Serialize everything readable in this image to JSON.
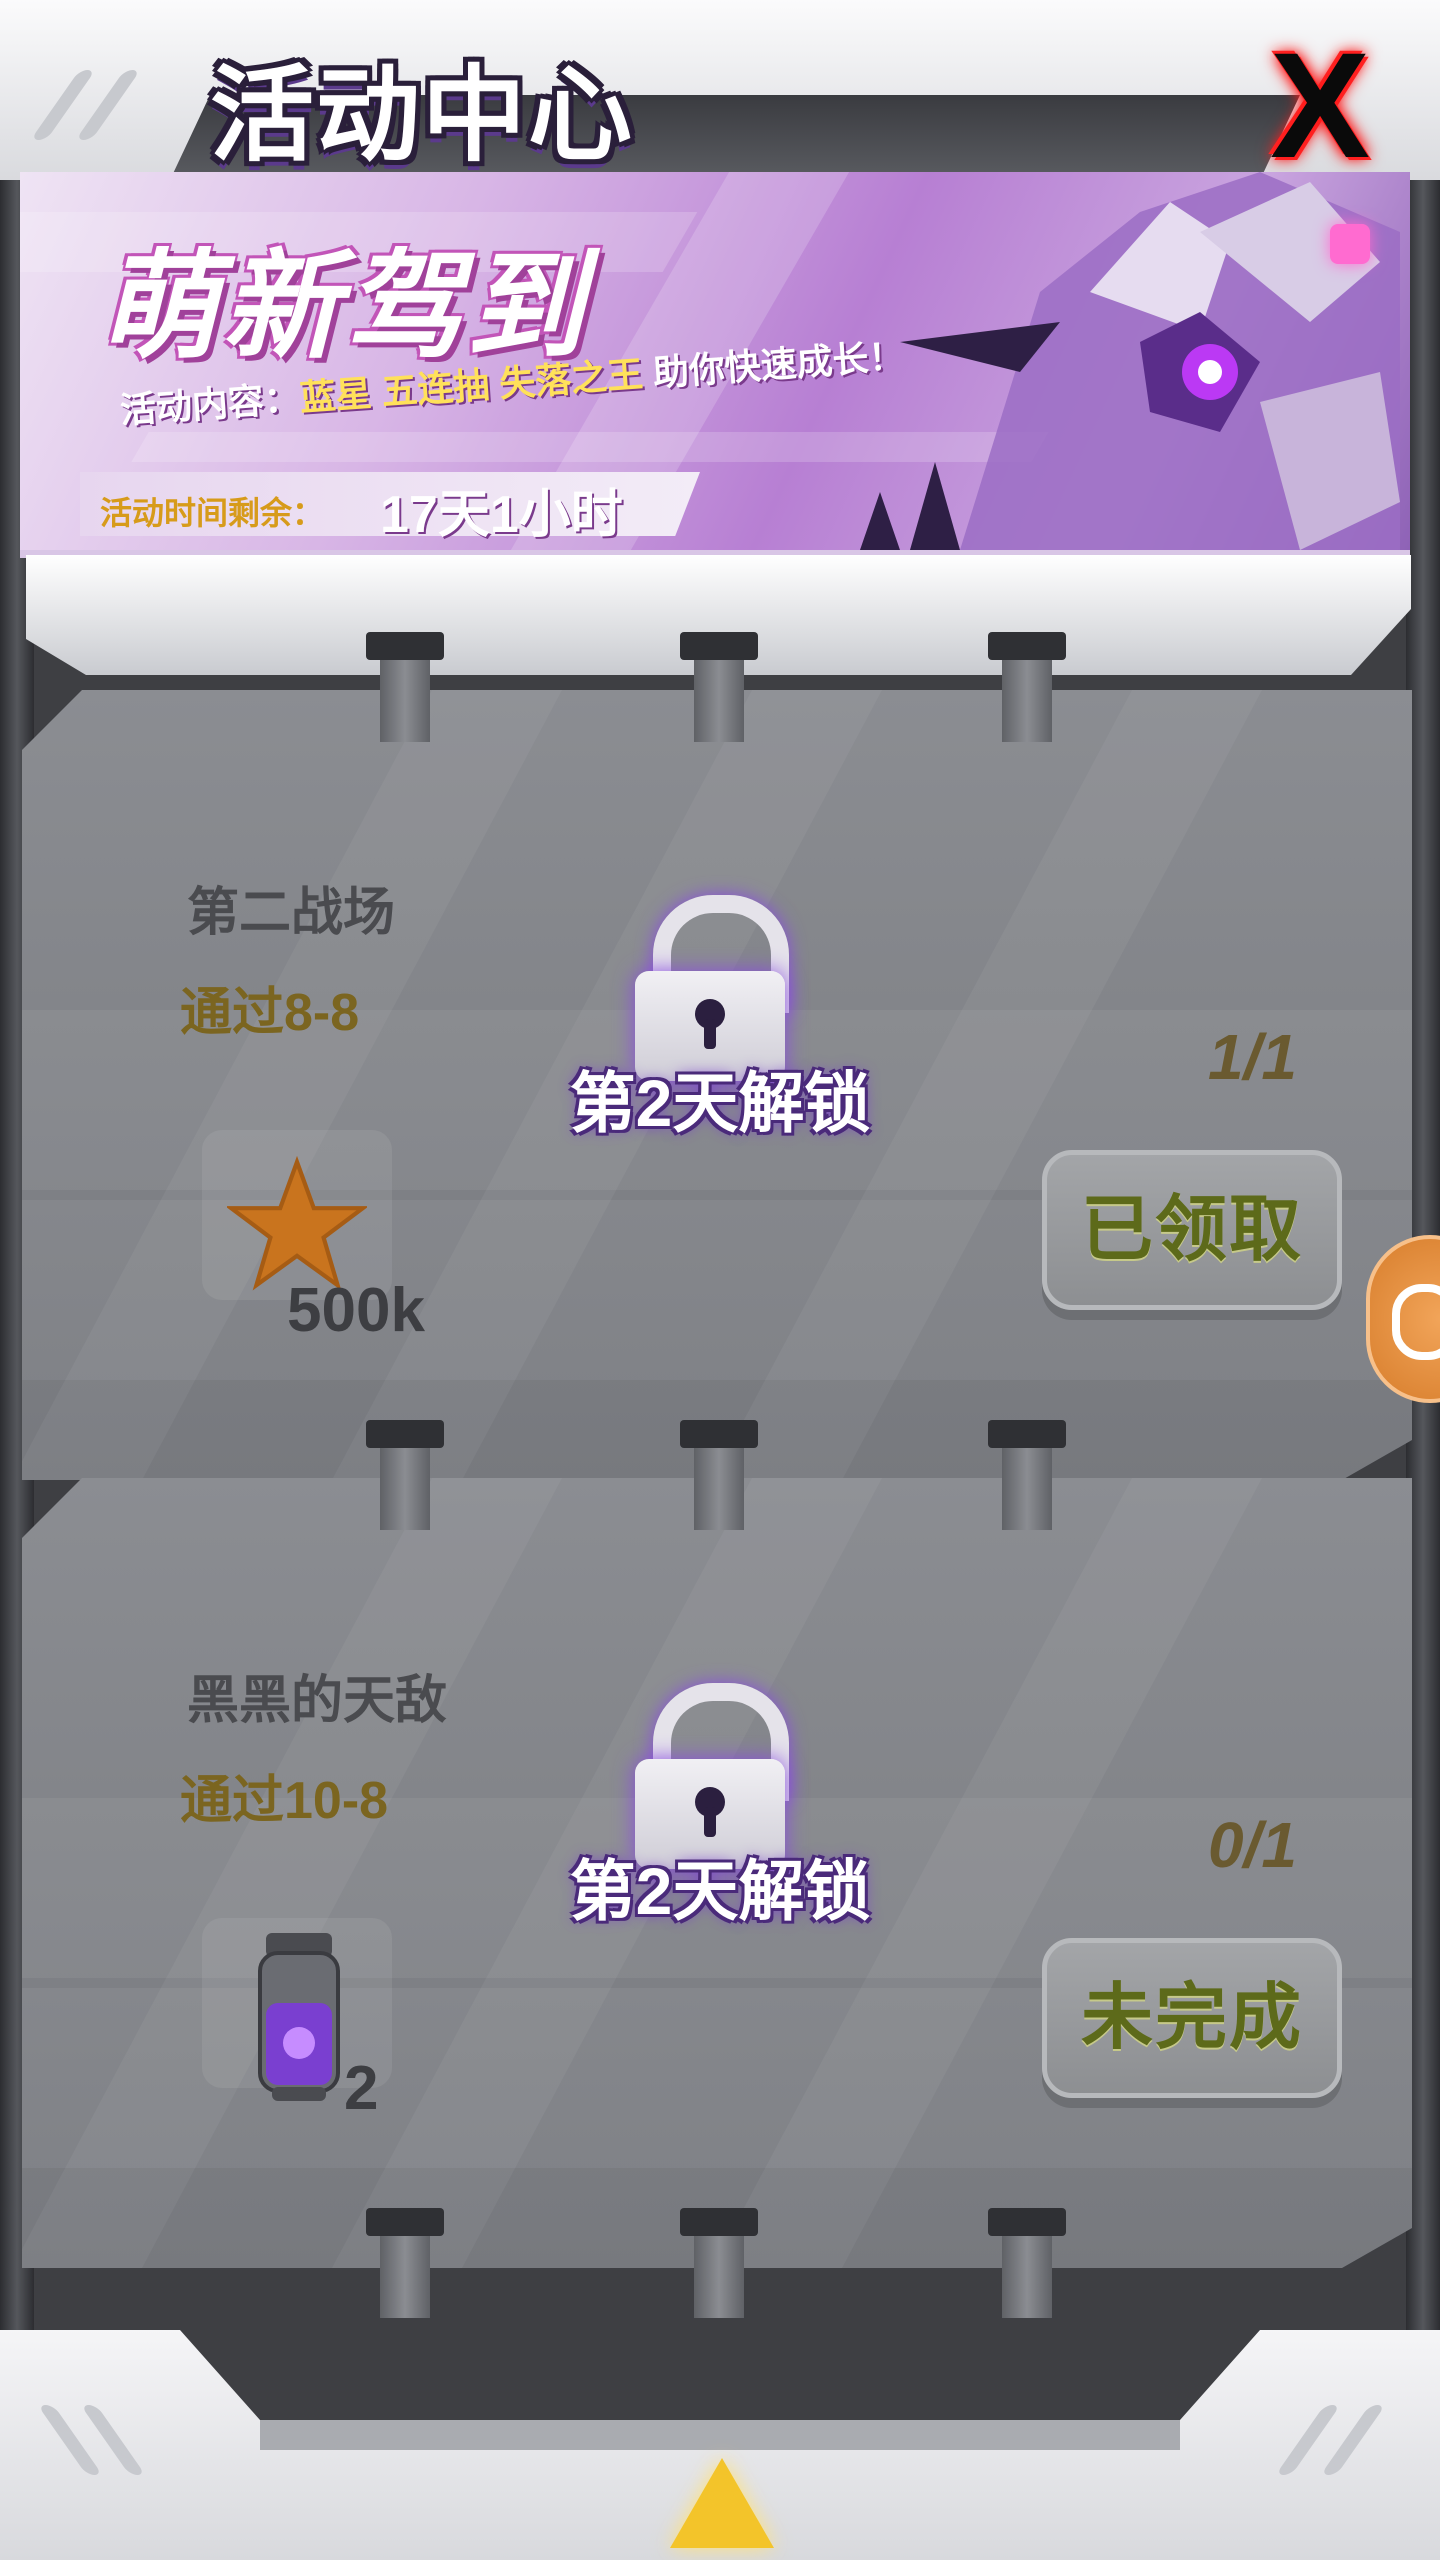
{
  "header": {
    "title": "活动中心",
    "close_label": "X"
  },
  "banner": {
    "title": "萌新驾到",
    "desc_prefix": "活动内容：",
    "desc_item1": "蓝星",
    "desc_item2": "五连抽",
    "desc_item3": "失落之王",
    "desc_suffix": "助你快速成长！",
    "time_label": "活动时间剩余：",
    "time_value": "17天1小时"
  },
  "tasks": [
    {
      "title": "第二战场",
      "condition": "通过8-8",
      "progress": "1/1",
      "reward_icon": "star-icon",
      "reward_count": "500k",
      "button_label": "已领取",
      "lock_text": "第2天解锁"
    },
    {
      "title": "黑黑的天敌",
      "condition": "通过10-8",
      "progress": "0/1",
      "reward_icon": "potion-icon",
      "reward_count": "2",
      "button_label": "未完成",
      "lock_text": "第2天解锁"
    }
  ],
  "colors": {
    "accent_purple": "#b77fd3",
    "highlight_yellow": "#ffe15a",
    "close_red": "#ff1a1a",
    "arrow_yellow": "#f3c42a"
  }
}
